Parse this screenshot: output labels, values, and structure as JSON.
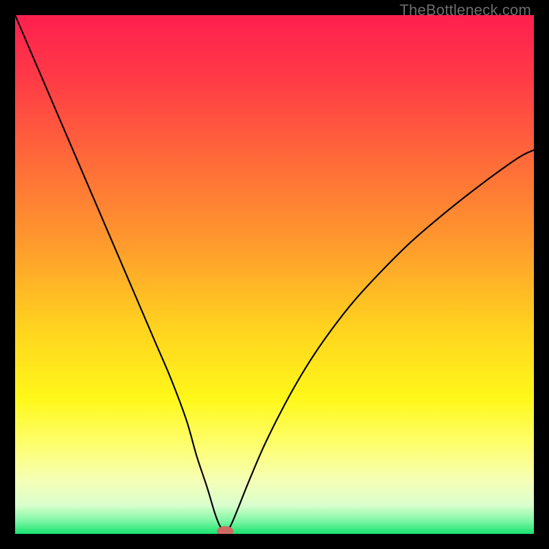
{
  "watermark": "TheBottleneck.com",
  "chart_data": {
    "type": "line",
    "title": "",
    "xlabel": "",
    "ylabel": "",
    "xlim": [
      0,
      100
    ],
    "ylim": [
      0,
      100
    ],
    "grid": false,
    "background_gradient": {
      "stops": [
        {
          "pos": 0.0,
          "color": "#ff1f4e"
        },
        {
          "pos": 0.12,
          "color": "#ff3a47"
        },
        {
          "pos": 0.28,
          "color": "#ff6a39"
        },
        {
          "pos": 0.44,
          "color": "#ff9a2d"
        },
        {
          "pos": 0.6,
          "color": "#ffd21f"
        },
        {
          "pos": 0.74,
          "color": "#fff81a"
        },
        {
          "pos": 0.84,
          "color": "#fdff7a"
        },
        {
          "pos": 0.9,
          "color": "#f4ffb8"
        },
        {
          "pos": 0.945,
          "color": "#d9ffcd"
        },
        {
          "pos": 0.975,
          "color": "#7ef6a4"
        },
        {
          "pos": 1.0,
          "color": "#19e36f"
        }
      ]
    },
    "series": [
      {
        "name": "bottleneck-curve",
        "color": "#000000",
        "width": 2.2,
        "x": [
          0,
          3,
          6,
          9,
          12,
          15,
          18,
          21,
          24,
          27,
          30,
          33,
          35,
          37,
          38.5,
          39.5,
          40.5,
          41.5,
          43,
          45,
          48,
          52,
          56,
          60,
          65,
          70,
          76,
          83,
          90,
          97,
          100
        ],
        "y": [
          100,
          93,
          86,
          79,
          72,
          65,
          58,
          51,
          44,
          37,
          30,
          22,
          15,
          9,
          4,
          1.5,
          0.5,
          1.5,
          5,
          10,
          17,
          25,
          32,
          38,
          44.5,
          50,
          56,
          62,
          67.5,
          72.5,
          74
        ]
      }
    ],
    "marker": {
      "name": "optimal-point",
      "x": 40.5,
      "y": 0.5,
      "rx": 1.6,
      "ry": 1.0,
      "color": "#cf6a62"
    }
  }
}
